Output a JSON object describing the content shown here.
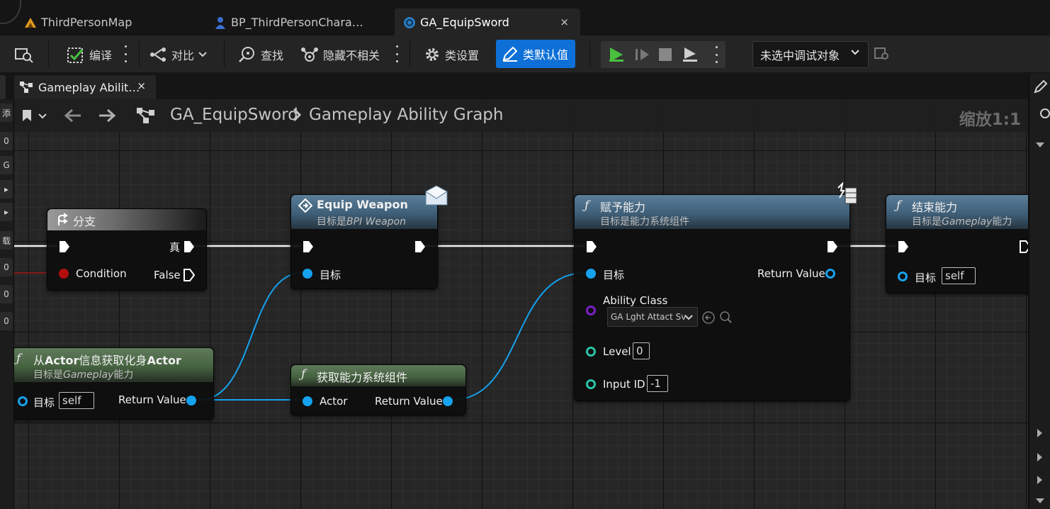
{
  "tabs": [
    {
      "label": "ThirdPersonMap",
      "icon": "level-icon"
    },
    {
      "label": "BP_ThirdPersonChara…",
      "icon": "character-icon"
    },
    {
      "label": "GA_EquipSword",
      "icon": "blueprint-icon",
      "close": "×"
    }
  ],
  "toolbar": {
    "compile": "编译",
    "diff": "对比",
    "find": "查找",
    "hide_unrelated": "隐藏不相关",
    "class_settings": "类设置",
    "class_defaults": "类默认值",
    "debug_object": "未选中调试对象"
  },
  "graph_tab": {
    "label": "Gameplay Abilit…",
    "close": "×"
  },
  "breadcrumb": {
    "blueprint": "GA_EquipSword",
    "graph": "Gameplay Ability Graph",
    "zoom": "缩放1:1"
  },
  "left_sidebar": [
    "添",
    "0",
    "G",
    "▸",
    "▸",
    "载",
    "0",
    "0",
    "0"
  ],
  "nodes": {
    "branch": {
      "title": "分支",
      "true_label": "真",
      "condition_label": "Condition",
      "false_label": "False"
    },
    "equip_weapon": {
      "title": "Equip Weapon",
      "subtitle_prefix": "目标是",
      "subtitle_target": "BPI Weapon",
      "target_label": "目标"
    },
    "give_ability": {
      "title": "赋予能力",
      "subtitle": "目标是能力系统组件",
      "target_label": "目标",
      "return_label": "Return Value",
      "ability_class_label": "Ability Class",
      "ability_class_value": "GA Lght Attact Sv",
      "level_label": "Level",
      "level_value": "0",
      "input_id_label": "Input ID",
      "input_id_value": "-1"
    },
    "end_ability": {
      "title": "结束能力",
      "subtitle_prefix": "目标是",
      "subtitle_target": "Gameplay",
      "subtitle_suffix": "能力",
      "target_label": "目标",
      "target_value": "self"
    },
    "get_avatar": {
      "title_prefix": "从",
      "title_bold": "Actor",
      "title_mid": "信息获取化身",
      "title_bold2": "Actor",
      "subtitle_prefix": "目标是",
      "subtitle_target": "Gameplay",
      "subtitle_suffix": "能力",
      "target_label": "目标",
      "target_value": "self",
      "return_label": "Return Value"
    },
    "get_asc": {
      "title": "获取能力系统组件",
      "actor_label": "Actor",
      "return_label": "Return Value"
    }
  },
  "colors": {
    "accent": "#0e70d6",
    "object_pin": "#15a2ee",
    "bool_pin": "#b30e0e",
    "int_pin": "#2bc3a5",
    "class_pin": "#7a1fc7",
    "exec_wire": "#ffffff"
  }
}
